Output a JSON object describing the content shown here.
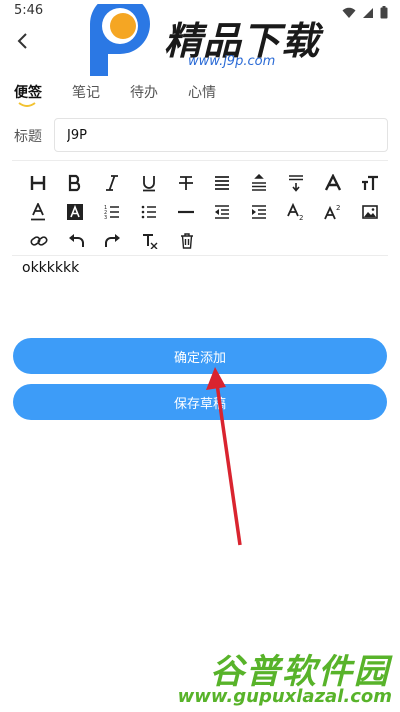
{
  "status_bar": {
    "time": "5:46",
    "icons": [
      "wifi-icon",
      "signal-icon",
      "battery-icon"
    ]
  },
  "header": {
    "back_icon": "back-arrow-icon"
  },
  "tabs": [
    {
      "label": "便签",
      "active": true
    },
    {
      "label": "笔记",
      "active": false
    },
    {
      "label": "待办",
      "active": false
    },
    {
      "label": "心情",
      "active": false
    }
  ],
  "title_field": {
    "label": "标题",
    "value": "J9P"
  },
  "toolbar": {
    "rows": [
      [
        "heading-icon",
        "bold-icon",
        "italic-icon",
        "underline-icon",
        "strikethrough-icon",
        "align-justify-icon",
        "line-height-icon",
        "indent-down-icon",
        "font-icon",
        "font-size-icon"
      ],
      [
        "text-color-icon",
        "background-color-icon",
        "ordered-list-icon",
        "unordered-list-icon",
        "horizontal-rule-icon",
        "outdent-icon",
        "indent-icon",
        "subscript-icon",
        "superscript-icon",
        "image-icon"
      ],
      [
        "link-icon",
        "undo-icon",
        "redo-icon",
        "clear-format-icon",
        "delete-icon"
      ]
    ]
  },
  "editor": {
    "content": "okkkkkk"
  },
  "buttons": {
    "confirm_add": "确定添加",
    "save_draft": "保存草稿"
  },
  "watermarks": {
    "top_title": "精品下载",
    "top_url": "www.j9p.com",
    "bottom_title": "谷普软件园",
    "bottom_url": "www.gupuxlazal.com"
  },
  "colors": {
    "accent": "#3d9cf8",
    "tab_underline": "#f2c230",
    "arrow": "#d9242f",
    "watermark_green": "#58b32a"
  }
}
